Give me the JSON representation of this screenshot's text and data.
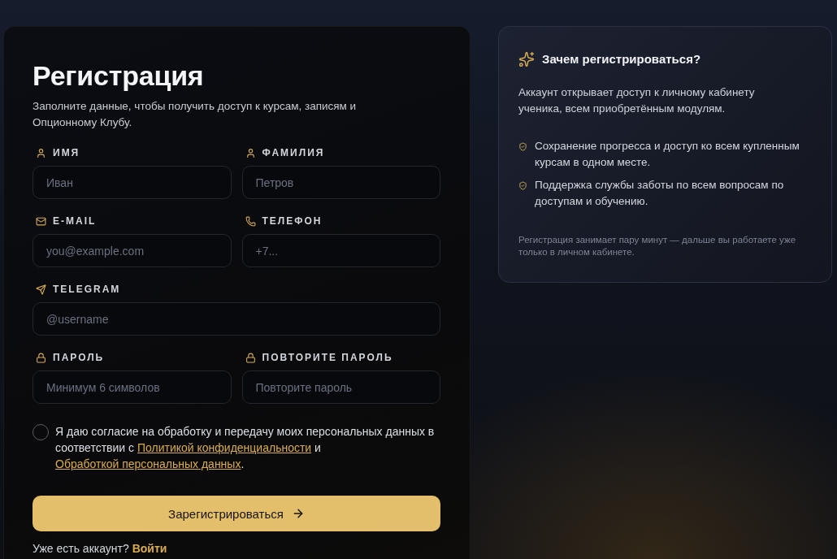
{
  "form": {
    "title": "Регистрация",
    "subtitle": "Заполните данные, чтобы получить доступ к курсам, записям и Опционному Клубу.",
    "rows": [
      [
        {
          "label": "ИМЯ",
          "placeholder": "Иван"
        },
        {
          "label": "ФАМИЛИЯ",
          "placeholder": "Петров"
        }
      ],
      [
        {
          "label": "E-MAIL",
          "placeholder": "you@example.com"
        },
        {
          "label": "ТЕЛЕФОН",
          "placeholder": "+7..."
        }
      ],
      [
        {
          "label": "TELEGRAM",
          "placeholder": "@username"
        }
      ],
      [
        {
          "label": "ПАРОЛЬ",
          "placeholder": "Минимум 6 символов"
        },
        {
          "label": "ПОВТОРИТЕ ПАРОЛЬ",
          "placeholder": "Повторите пароль"
        }
      ]
    ],
    "consent": {
      "checked": false,
      "parts": [
        {
          "kind": "text",
          "text": "Я даю согласие на обработку и передачу моих персональных данных в соответствии с "
        },
        {
          "kind": "link",
          "text": "Политикой конфиденциальности"
        },
        {
          "kind": "text",
          "text": " и "
        },
        {
          "kind": "link",
          "text": "Обработкой персональных данных"
        },
        {
          "kind": "text",
          "text": "."
        }
      ]
    },
    "submit": {
      "label": "Зарегистрироваться"
    },
    "login": {
      "text": "Уже есть аккаунт?",
      "link": "Войти"
    }
  },
  "info": {
    "title": "Зачем регистрироваться?",
    "intro": "Аккаунт открывает доступ к личному кабинету ученика, всем приобретённым модулям.",
    "bullets": [
      "Сохранение прогресса и доступ ко всем купленным курсам в одном месте.",
      "Поддержка службы заботы по всем вопросам по доступам и обучению."
    ],
    "note": "Регистрация занимает пару минут — дальше вы работаете уже только в личном кабинете."
  }
}
